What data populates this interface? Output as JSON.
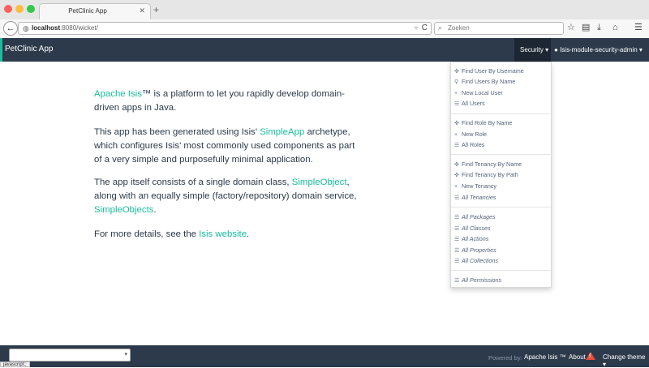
{
  "browser": {
    "tab_title": "PetClinic App",
    "tab_close": "✕",
    "new_tab": "+",
    "back": "←",
    "url_host": "localhost",
    "url_path": ":8080/wicket/",
    "url_dropdown": "▿",
    "reload": "C",
    "search_placeholder": "Zoeken",
    "icons": [
      "star-icon",
      "clipboard-icon",
      "download-icon",
      "home-icon",
      "menu-icon"
    ],
    "status_text": "javascript:;"
  },
  "navbar": {
    "brand": "PetClinic App",
    "security_menu": "Security ▾",
    "user_menu": "Isis-module-security-admin ▾"
  },
  "content": {
    "p1_link": "Apache Isis",
    "p1_text": "™ is a platform to let you rapidly develop domain-driven apps in Java.",
    "p2_a": "This app has been generated using Isis' ",
    "p2_link": "SimpleApp",
    "p2_b": " archetype, which configures Isis' most commonly used components as part of a very simple and purposefully minimal application.",
    "p3_a": "The app itself consists of a single domain class, ",
    "p3_link1": "SimpleObject",
    "p3_b": ", along with an equally simple (factory/repository) domain service, ",
    "p3_link2": "SimpleObjects",
    "p3_c": ".",
    "p4_a": "For more details, see the ",
    "p4_link": "Isis website",
    "p4_b": "."
  },
  "dropdown": {
    "items": [
      {
        "icon": "crosshair-icon",
        "label": "Find User By Username"
      },
      {
        "icon": "search-icon",
        "label": "Find Users By Name"
      },
      {
        "icon": "plus-icon",
        "label": "New Local User"
      },
      {
        "icon": "list-icon",
        "label": "All Users"
      },
      {
        "icon": "crosshair-icon",
        "label": "Find Role By Name"
      },
      {
        "icon": "plus-icon",
        "label": "New Role"
      },
      {
        "icon": "list-icon",
        "label": "All Roles"
      },
      {
        "icon": "crosshair-icon",
        "label": "Find Tenancy By Name"
      },
      {
        "icon": "crosshair-icon",
        "label": "Find Tenancy By Path"
      },
      {
        "icon": "plus-icon",
        "label": "New Tenancy"
      },
      {
        "icon": "list-icon",
        "label": "All Tenancies"
      },
      {
        "icon": "list-icon",
        "label": "All Packages"
      },
      {
        "icon": "list-icon",
        "label": "All Classes"
      },
      {
        "icon": "list-icon",
        "label": "All Actions"
      },
      {
        "icon": "list-icon",
        "label": "All Properties"
      },
      {
        "icon": "list-icon",
        "label": "All Collections"
      },
      {
        "icon": "list-icon",
        "label": "All Permissions"
      }
    ]
  },
  "footer": {
    "select_arrow": "▾",
    "powered_by": "Powered by:",
    "apache_isis": "Apache Isis ™",
    "about": "About",
    "warn_mark": "!",
    "change_theme": "Change theme ▾"
  },
  "colors": {
    "navbar": "#2c3a4b",
    "accent": "#18bc9c",
    "warning": "#e74c3c"
  }
}
